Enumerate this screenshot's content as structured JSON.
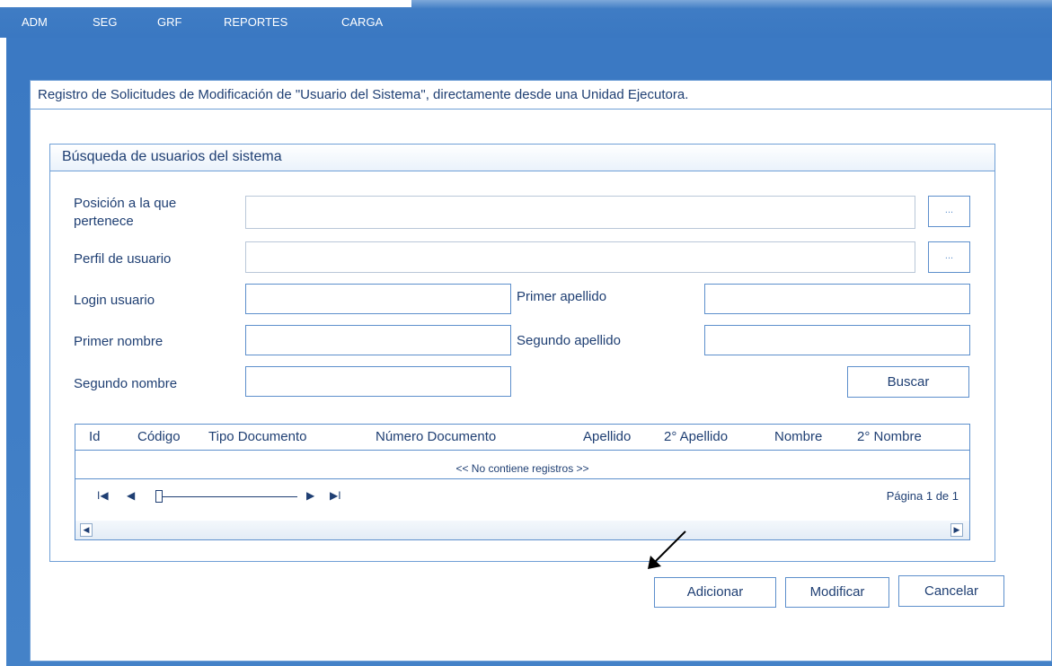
{
  "menu": {
    "items": [
      {
        "label": "ADM"
      },
      {
        "label": "SEG"
      },
      {
        "label": "GRF"
      },
      {
        "label": "REPORTES"
      },
      {
        "label": "CARGA"
      }
    ]
  },
  "page": {
    "title": "Registro de Solicitudes de Modificación de \"Usuario del Sistema\", directamente desde una Unidad Ejecutora."
  },
  "search": {
    "title": "Búsqueda de usuarios del sistema",
    "position_label": "Posición a la que pertenece",
    "profile_label": "Perfil de usuario",
    "login_label": "Login usuario",
    "first_name_label": "Primer nombre",
    "second_name_label": "Segundo nombre",
    "first_lastname_label": "Primer apellido",
    "second_lastname_label": "Segundo apellido",
    "lookup_button": "...",
    "search_button": "Buscar"
  },
  "grid": {
    "columns": [
      "Id",
      "Código",
      "Tipo Documento",
      "Número Documento",
      "Apellido",
      "2° Apellido",
      "Nombre",
      "2° Nombre"
    ],
    "empty_message": "<< No contiene registros >>",
    "page_info": "Página 1 de 1"
  },
  "actions": {
    "add": "Adicionar",
    "modify": "Modificar",
    "cancel": "Cancelar"
  },
  "colors": {
    "menu_bg": "#3f7cc4",
    "text": "#1f3f73",
    "border": "#5d8fcc"
  },
  "icons": {
    "first_page": "first-page-icon",
    "prev_page": "prev-page-icon",
    "next_page": "next-page-icon",
    "last_page": "last-page-icon",
    "scroll_left": "scroll-left-icon",
    "scroll_right": "scroll-right-icon"
  }
}
